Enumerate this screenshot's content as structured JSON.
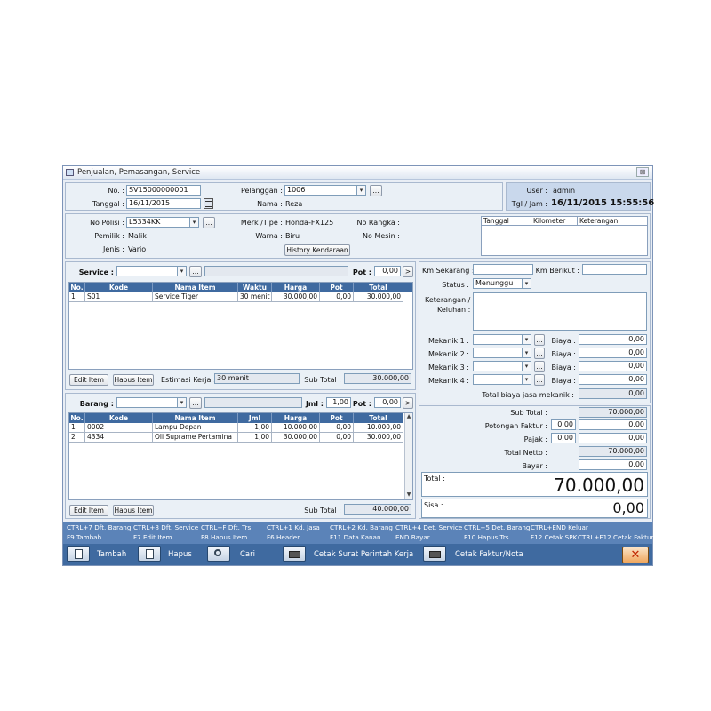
{
  "window": {
    "title": "Penjualan, Pemasangan, Service"
  },
  "header": {
    "no_label": "No. :",
    "no_value": "SV15000000001",
    "tanggal_label": "Tanggal :",
    "tanggal_value": "16/11/2015",
    "pelanggan_label": "Pelanggan :",
    "pelanggan_value": "1006",
    "nama_label": "Nama :",
    "nama_value": "Reza",
    "user_label": "User :",
    "user_value": "admin",
    "tgljam_label": "Tgl / Jam :",
    "tgljam_value": "16/11/2015 15:55:56",
    "ellipsis": "..."
  },
  "vehicle": {
    "nopolisi_label": "No Polisi :",
    "nopolisi_value": "L5334KK",
    "pemilik_label": "Pemilik :",
    "pemilik_value": "Malik",
    "jenis_label": "Jenis :",
    "jenis_value": "Vario",
    "merk_label": "Merk /Tipe :",
    "merk_value": "Honda-FX125",
    "warna_label": "Warna :",
    "warna_value": "Biru",
    "norangka_label": "No Rangka :",
    "nomesin_label": "No Mesin :",
    "history_button": "History Kendaraan",
    "history_columns": [
      "Tanggal",
      "Kilometer",
      "Keterangan"
    ]
  },
  "service": {
    "label": "Service :",
    "pot_label": "Pot :",
    "pot_value": "0,00",
    "go": ">",
    "columns": [
      "No.",
      "Kode",
      "Nama Item",
      "Waktu",
      "Harga",
      "Pot",
      "Total"
    ],
    "rows": [
      {
        "no": "1",
        "kode": "S01",
        "nama": "Service Tiger",
        "waktu": "30 menit",
        "harga": "30.000,00",
        "pot": "0,00",
        "total": "30.000,00"
      }
    ],
    "edit_button": "Edit Item",
    "hapus_button": "Hapus Item",
    "estimasi_label": "Estimasi Kerja :",
    "estimasi_value": "30 menit",
    "subtotal_label": "Sub Total :",
    "subtotal_value": "30.000,00"
  },
  "barang": {
    "label": "Barang :",
    "jml_label": "Jml :",
    "jml_value": "1,00",
    "pot_label": "Pot :",
    "pot_value": "0,00",
    "go": ">",
    "columns": [
      "No.",
      "Kode",
      "Nama Item",
      "Jml",
      "Harga",
      "Pot",
      "Total"
    ],
    "rows": [
      {
        "no": "1",
        "kode": "0002",
        "nama": "Lampu Depan",
        "jml": "1,00",
        "harga": "10.000,00",
        "pot": "0,00",
        "total": "10.000,00"
      },
      {
        "no": "2",
        "kode": "4334",
        "nama": "Oli Suprame Pertamina",
        "jml": "1,00",
        "harga": "30.000,00",
        "pot": "0,00",
        "total": "30.000,00"
      }
    ],
    "edit_button": "Edit Item",
    "hapus_button": "Hapus Item",
    "subtotal_label": "Sub Total :",
    "subtotal_value": "40.000,00"
  },
  "service_info": {
    "km_sekarang_label": "Km Sekarang :",
    "km_berikut_label": "Km Berikut :",
    "status_label": "Status :",
    "status_value": "Menunggu",
    "keterangan_label": "Keterangan /",
    "keluhan_label": "Keluhan :",
    "mekanik": [
      {
        "label": "Mekanik 1 :",
        "biaya_label": "Biaya :",
        "biaya": "0,00"
      },
      {
        "label": "Mekanik 2 :",
        "biaya_label": "Biaya :",
        "biaya": "0,00"
      },
      {
        "label": "Mekanik 3 :",
        "biaya_label": "Biaya :",
        "biaya": "0,00"
      },
      {
        "label": "Mekanik 4 :",
        "biaya_label": "Biaya :",
        "biaya": "0,00"
      }
    ],
    "total_biaya_label": "Total biaya jasa mekanik :",
    "total_biaya_value": "0,00"
  },
  "summary": {
    "subtotal_label": "Sub Total :",
    "subtotal_value": "70.000,00",
    "potongan_label": "Potongan Faktur :",
    "potongan_pct": "0,00",
    "potongan_value": "0,00",
    "pajak_label": "Pajak :",
    "pajak_pct": "0,00",
    "pajak_value": "0,00",
    "netto_label": "Total Netto :",
    "netto_value": "70.000,00",
    "bayar_label": "Bayar :",
    "bayar_value": "0,00",
    "total_label": "Total :",
    "total_value": "70.000,00",
    "sisa_label": "Sisa :",
    "sisa_value": "0,00"
  },
  "shortcuts": {
    "row1": [
      "CTRL+7 Dft. Barang",
      "CTRL+8 Dft. Service",
      "CTRL+F Dft. Trs",
      "CTRL+1 Kd. Jasa",
      "CTRL+2 Kd. Barang",
      "CTRL+4 Det. Service",
      "CTRL+5 Det. Barang",
      "CTRL+END Keluar"
    ],
    "row2": [
      "F9 Tambah",
      "F7 Edit Item",
      "F8 Hapus Item",
      "F6 Header",
      "F11 Data Kanan",
      "END Bayar",
      "F10 Hapus Trs",
      "F12 Cetak SPK",
      "CTRL+F12 Cetak Faktur"
    ]
  },
  "toolbar": {
    "tambah": "Tambah",
    "hapus": "Hapus",
    "cari": "Cari",
    "cetak_spk": "Cetak Surat Perintah Kerja",
    "cetak_faktur": "Cetak Faktur/Nota",
    "close": "✕"
  },
  "colors": {
    "accent": "#3f6aa0",
    "shortcut_bar": "#5b83b8",
    "user_panel": "#c9d8ec"
  }
}
